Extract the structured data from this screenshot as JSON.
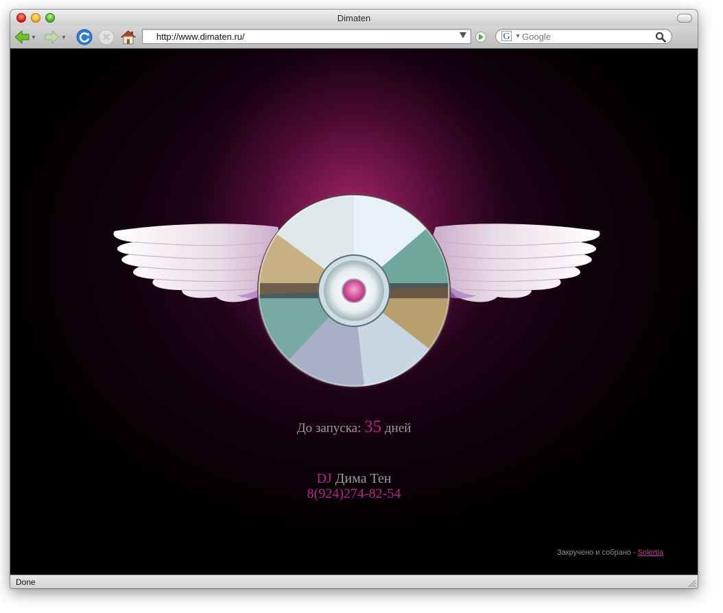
{
  "window": {
    "title": "Dimaten"
  },
  "toolbar": {
    "back_icon": "back-arrow-icon",
    "forward_icon": "forward-arrow-icon",
    "reload_icon": "reload-icon",
    "stop_icon": "stop-icon",
    "home_icon": "home-icon",
    "url": "http://www.dimaten.ru/",
    "search_placeholder": "Google",
    "search_engine_letter": "G"
  },
  "page": {
    "countdown_label": "До запуска:",
    "countdown_value": "35",
    "countdown_unit": "дней",
    "dj_prefix": "DJ",
    "dj_name": "Дима Тен",
    "phone": "8(924)274-82-54",
    "credits_text": "Закручено и собрано -",
    "credits_link": "Solertia"
  },
  "status": {
    "text": "Done"
  },
  "colors": {
    "accent": "#b8248a",
    "text_gray": "#9a9aa0",
    "background": "#000000",
    "glow": "#b4286e"
  }
}
